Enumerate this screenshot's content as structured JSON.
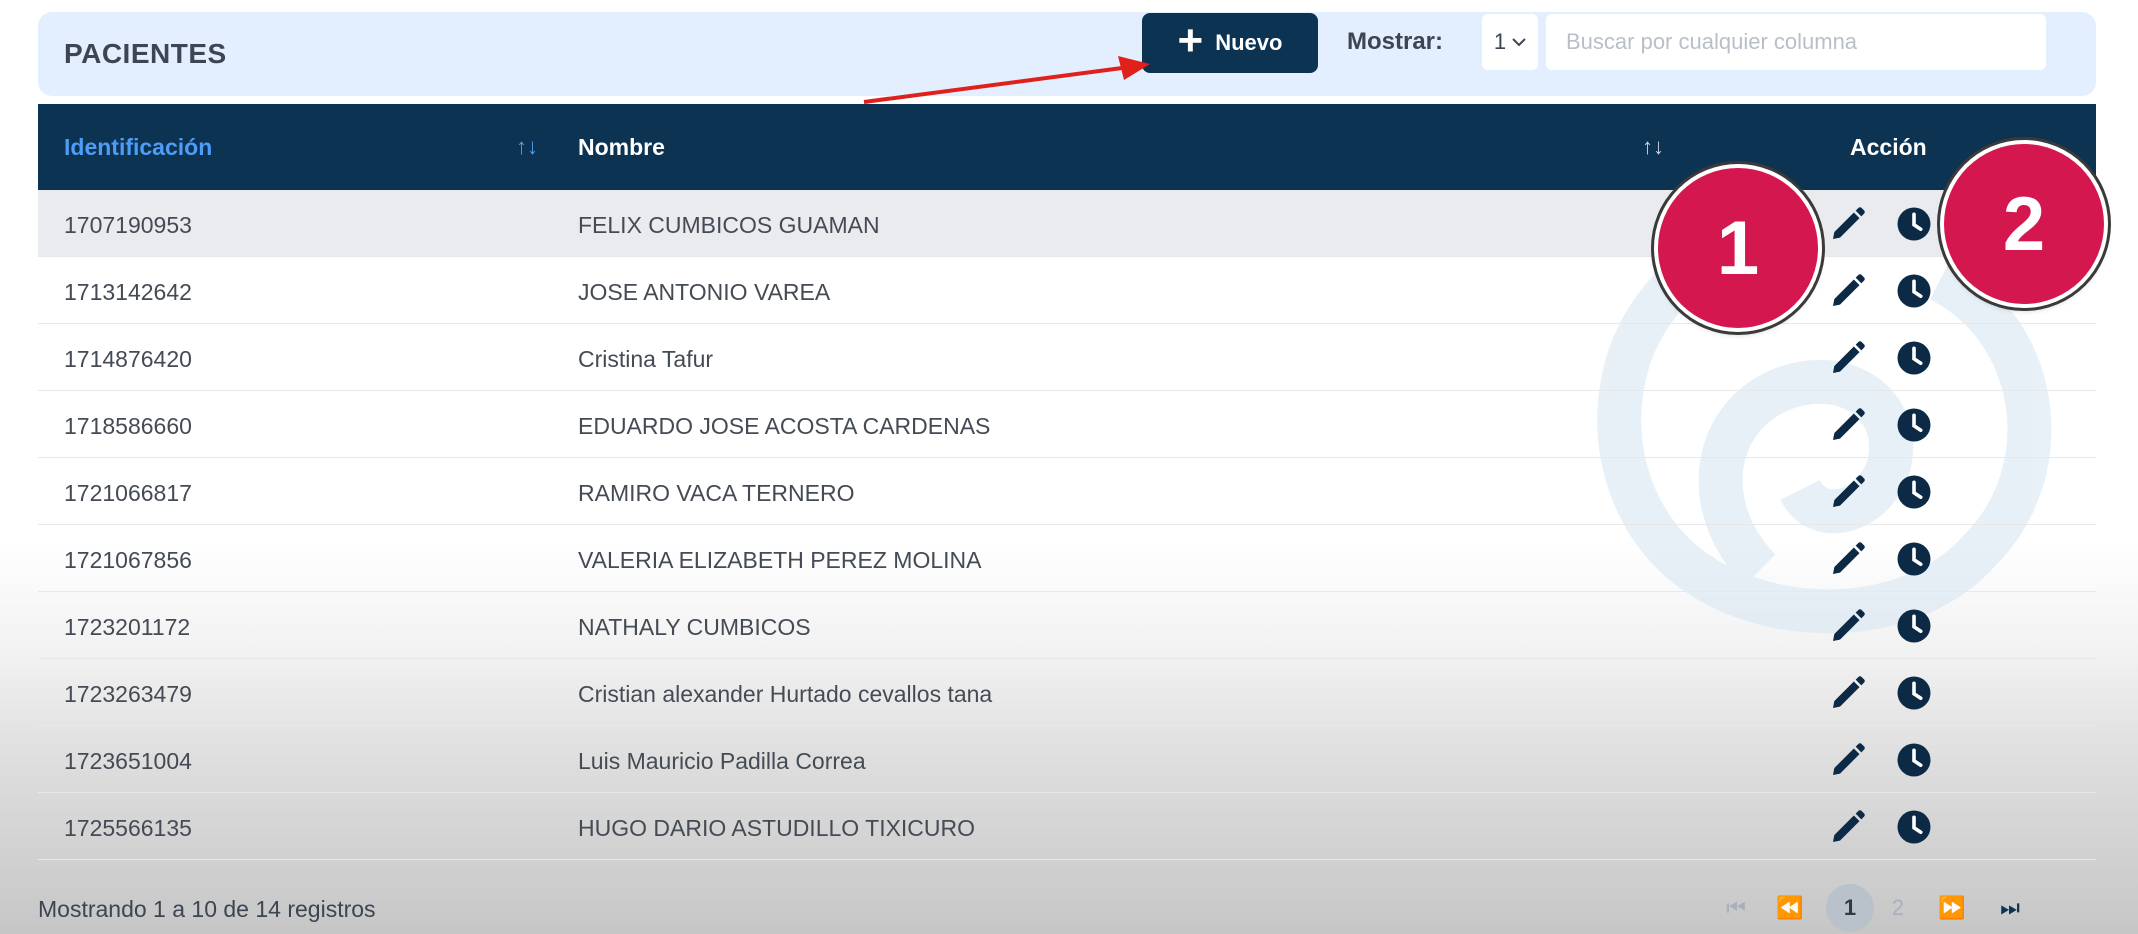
{
  "header": {
    "title": "PACIENTES",
    "new_button_label": "Nuevo",
    "show_label": "Mostrar:",
    "show_value": "1",
    "search_placeholder": "Buscar por cualquier columna"
  },
  "table": {
    "columns": [
      "Identificación",
      "Nombre",
      "Acción"
    ],
    "rows": [
      {
        "id": "1707190953",
        "name": "FELIX CUMBICOS GUAMAN"
      },
      {
        "id": "1713142642",
        "name": "JOSE ANTONIO VAREA"
      },
      {
        "id": "1714876420",
        "name": "Cristina Tafur"
      },
      {
        "id": "1718586660",
        "name": "EDUARDO JOSE ACOSTA CARDENAS"
      },
      {
        "id": "1721066817",
        "name": "RAMIRO VACA TERNERO"
      },
      {
        "id": "1721067856",
        "name": "VALERIA ELIZABETH PEREZ MOLINA"
      },
      {
        "id": "1723201172",
        "name": "NATHALY CUMBICOS"
      },
      {
        "id": "1723263479",
        "name": "Cristian alexander Hurtado cevallos tana"
      },
      {
        "id": "1723651004",
        "name": "Luis Mauricio Padilla Correa"
      },
      {
        "id": "1725566135",
        "name": "HUGO DARIO ASTUDILLO TIXICURO"
      }
    ],
    "action_icons": [
      "pencil-icon",
      "clock-icon"
    ]
  },
  "footer": {
    "info": "Mostrando 1 a 10 de 14 registros",
    "pages": [
      "1",
      "2"
    ],
    "current_page": "1"
  },
  "annotations": {
    "badge_1": "1",
    "badge_2": "2"
  },
  "colors": {
    "header_bg": "#e3efff",
    "table_header_bg": "#0c3352",
    "primary": "#0c3352",
    "badge": "#d4184f",
    "arrow": "#e0211b",
    "sort_active": "#4e9cf5"
  }
}
